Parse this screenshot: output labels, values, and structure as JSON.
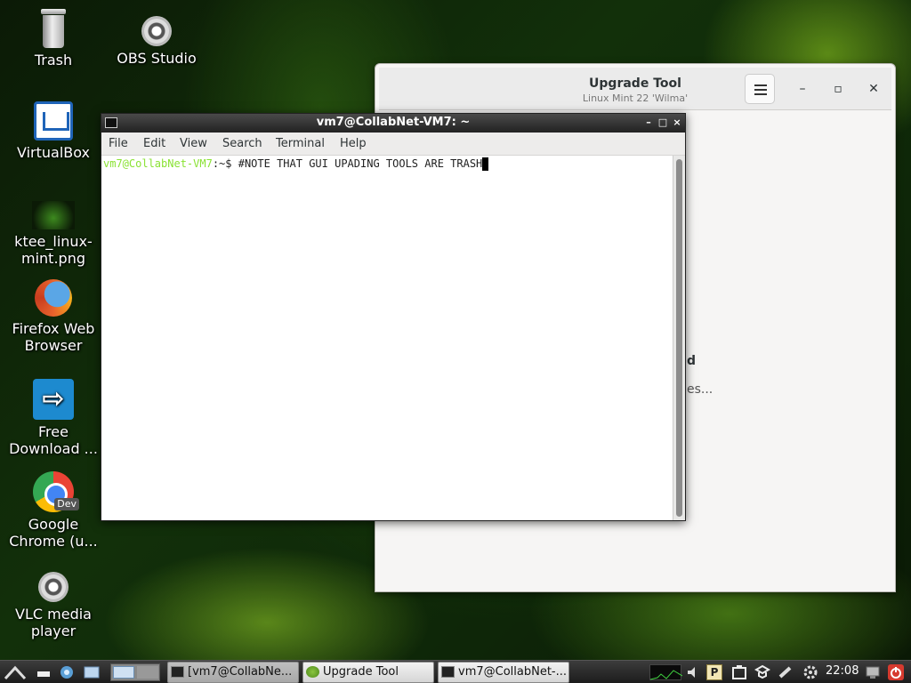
{
  "desktop": {
    "icons": [
      {
        "label": "Trash"
      },
      {
        "label": "OBS Studio"
      },
      {
        "label": "VirtualBox"
      },
      {
        "label": "ktee_linux-mint.png"
      },
      {
        "label": "Firefox Web Browser"
      },
      {
        "label": "Free Download ..."
      },
      {
        "label": "Google Chrome (u..."
      },
      {
        "label": "VLC media player"
      }
    ],
    "chrome_badge": "Dev"
  },
  "upgrade_window": {
    "title": "Upgrade Tool",
    "subtitle": "Linux Mint 22 'Wilma'",
    "partial_text_1": "d",
    "partial_text_2": "es..."
  },
  "terminal": {
    "title": "vm7@CollabNet-VM7: ~",
    "menu": [
      "File",
      "Edit",
      "View",
      "Search",
      "Terminal",
      "Help"
    ],
    "prompt_user": "vm7@CollabNet-VM7",
    "prompt_rest": ":~$ ",
    "command": "#NOTE THAT GUI UPADING TOOLS ARE TRASH"
  },
  "taskbar": {
    "tasks": [
      {
        "label": "[vm7@CollabNe..."
      },
      {
        "label": "Upgrade Tool"
      },
      {
        "label": "vm7@CollabNet-..."
      }
    ],
    "clock": "22:08"
  }
}
